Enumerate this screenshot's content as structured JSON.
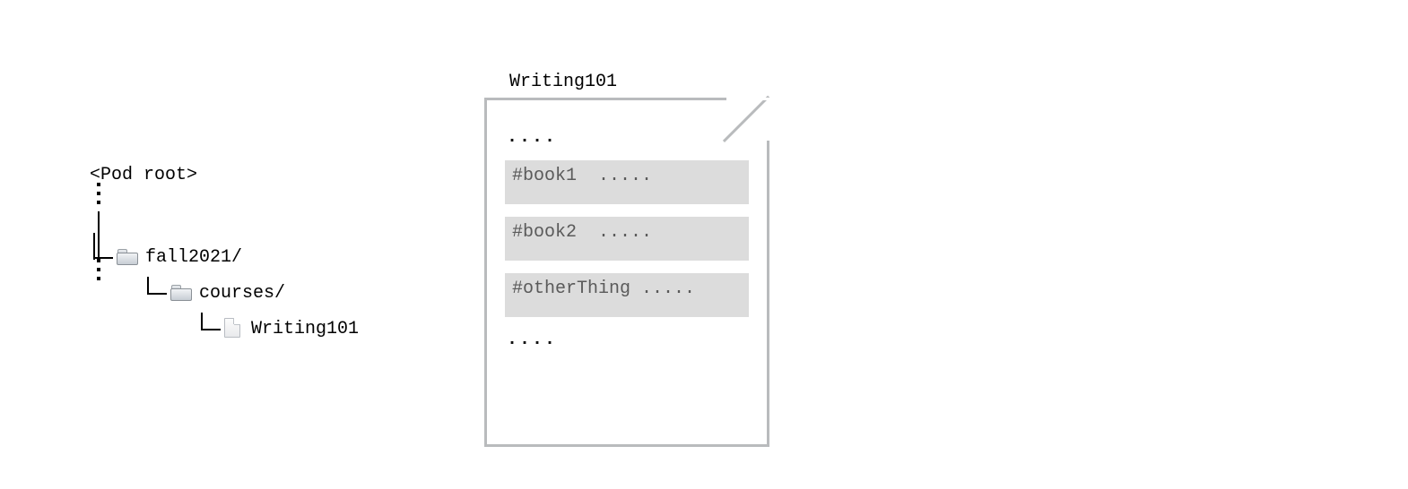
{
  "tree": {
    "root_label": "<Pod root>",
    "nodes": [
      {
        "type": "folder",
        "label": "fall2021/"
      },
      {
        "type": "folder",
        "label": "courses/"
      },
      {
        "type": "file",
        "label": "Writing101"
      }
    ]
  },
  "document": {
    "title": "Writing101",
    "ellipsis_top": "....",
    "ellipsis_bottom": "....",
    "fragments": [
      "#book1  .....",
      "#book2  .....",
      "#otherThing ....."
    ]
  }
}
